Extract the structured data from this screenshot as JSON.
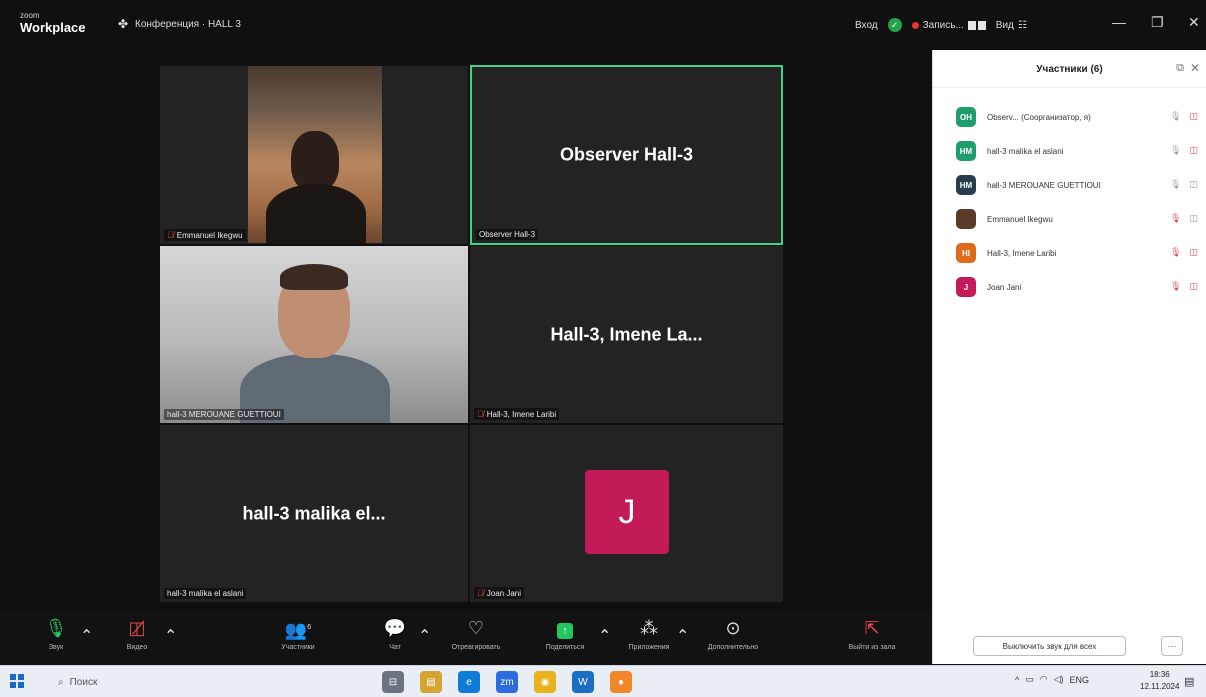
{
  "titlebar": {
    "brand_small": "zoom",
    "brand_large": "Workplace",
    "meeting_title": "Конференция · HALL 3",
    "login": "Вход",
    "recording": "Запись...",
    "view": "Вид"
  },
  "tiles": [
    {
      "name": "Emmanuel Ikegwu",
      "label": "Emmanuel Ikegwu",
      "mic_off": true
    },
    {
      "name": "Observer Hall-3",
      "label": "Observer Hall-3",
      "mic_off": false
    },
    {
      "name": "hall-3 MEROUANE GUETTIOUI",
      "label": "hall-3 MEROUANE GUETTIOUI",
      "mic_off": false
    },
    {
      "name": "Hall-3, Imene La...",
      "label": "Hall-3, Imene Laribi",
      "mic_off": true
    },
    {
      "name": "hall-3 malika el...",
      "label": "hall-3 malika el aslani",
      "mic_off": false
    },
    {
      "name": "J",
      "label": "Joan Jani",
      "mic_off": true
    }
  ],
  "participants_panel": {
    "title": "Участники (6)",
    "mute_all_label": "Выключить звук для всех",
    "more_label": "···",
    "items": [
      {
        "initials": "OH",
        "name": "Observ...  (Соорганизатор, я)",
        "color": "#1f9d6b",
        "mic_off": false,
        "cam_off": true
      },
      {
        "initials": "HM",
        "name": "hall-3 malika el aslani",
        "color": "#1f9d6b",
        "mic_off": false,
        "cam_off": true
      },
      {
        "initials": "HM",
        "name": "hall-3 MEROUANE GUETTIOUI",
        "color": "#2a3b4e",
        "mic_off": false,
        "cam_off": false
      },
      {
        "initials": "",
        "name": "Emmanuel Ikegwu",
        "color": "#5a3b2a",
        "mic_off": true,
        "cam_off": false
      },
      {
        "initials": "HI",
        "name": "Hall-3, Imene Laribi",
        "color": "#e06a1b",
        "mic_off": true,
        "cam_off": true
      },
      {
        "initials": "J",
        "name": "Joan Jani",
        "color": "#c31a5a",
        "mic_off": true,
        "cam_off": true
      }
    ]
  },
  "toolbar": {
    "audio": "Звук",
    "video": "Видео",
    "participants": "Участники",
    "participants_count": "6",
    "chat": "Чат",
    "react": "Отреагировать",
    "share": "Поделиться",
    "apps": "Приложения",
    "more": "Дополнительно",
    "leave": "Выйти из зала"
  },
  "taskbar": {
    "search_placeholder": "Поиск",
    "lang": "ENG",
    "time": "18:36",
    "date": "12.11.2024"
  },
  "colors": {
    "active_speaker_border": "#3bd48a",
    "muted_red": "#e5484d",
    "share_green": "#22c55e",
    "avatar_j": "#c31a5a"
  }
}
